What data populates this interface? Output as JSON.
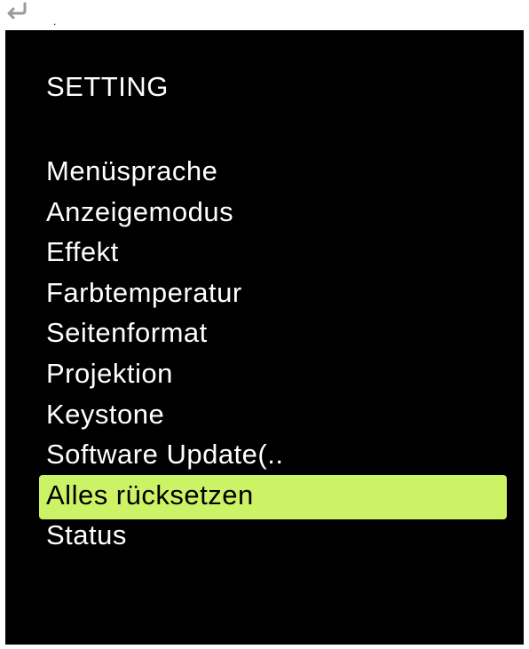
{
  "top": {
    "back_icon": "return-arrow-icon",
    "dot_text": "."
  },
  "menu": {
    "title": "SETTING",
    "items": [
      {
        "label": "Menüsprache"
      },
      {
        "label": "Anzeigemodus"
      },
      {
        "label": "Effekt"
      },
      {
        "label": "Farbtemperatur"
      },
      {
        "label": "Seitenformat"
      },
      {
        "label": "Projektion"
      },
      {
        "label": "Keystone"
      },
      {
        "label": "Software Update(.."
      },
      {
        "label": "Alles rücksetzen"
      },
      {
        "label": "Status"
      }
    ],
    "selected_index": 8
  },
  "colors": {
    "background": "#000000",
    "text": "#ffffff",
    "highlight": "#ccf266",
    "highlight_text": "#000000"
  }
}
